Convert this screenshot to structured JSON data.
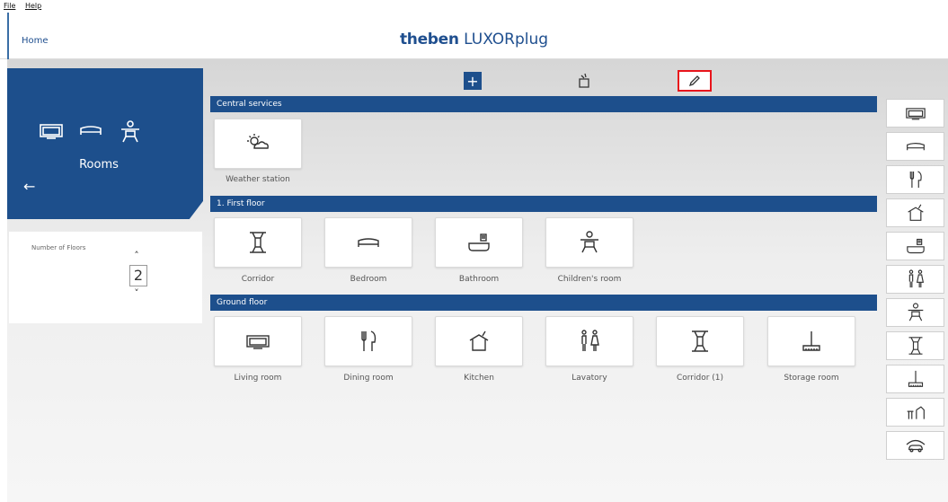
{
  "menu": {
    "file": "File",
    "help": "Help"
  },
  "header": {
    "home": "Home",
    "brand_bold": "theben",
    "brand_rest": "LUXORplug"
  },
  "rooms_panel": {
    "label": "Rooms",
    "back": "←"
  },
  "floors": {
    "label": "Number of Floors",
    "value": "2",
    "up": "˄",
    "down": "˅"
  },
  "toolbar": {
    "add": "+"
  },
  "sections": [
    {
      "title": "Central services",
      "tiles": [
        {
          "label": "Weather station",
          "icon": "weather-icon"
        }
      ]
    },
    {
      "title": "1. First floor",
      "tiles": [
        {
          "label": "Corridor",
          "icon": "corridor-icon"
        },
        {
          "label": "Bedroom",
          "icon": "bed-icon"
        },
        {
          "label": "Bathroom",
          "icon": "bathtub-icon"
        },
        {
          "label": "Children's room",
          "icon": "child-icon"
        }
      ]
    },
    {
      "title": "Ground floor",
      "tiles": [
        {
          "label": "Living room",
          "icon": "tv-icon"
        },
        {
          "label": "Dining room",
          "icon": "cutlery-icon"
        },
        {
          "label": "Kitchen",
          "icon": "pot-icon"
        },
        {
          "label": "Lavatory",
          "icon": "wc-icon"
        },
        {
          "label": "Corridor (1)",
          "icon": "corridor-icon"
        },
        {
          "label": "Storage room",
          "icon": "broom-icon"
        }
      ]
    }
  ],
  "right_column_icons": [
    "tv-icon",
    "bed-icon",
    "cutlery-icon",
    "pot-icon",
    "bathtub-icon",
    "wc-icon",
    "child-icon",
    "corridor-icon",
    "broom-icon",
    "desk-icon",
    "car-icon"
  ],
  "colors": {
    "primary": "#1d4f8c",
    "highlight": "#e8141b"
  }
}
